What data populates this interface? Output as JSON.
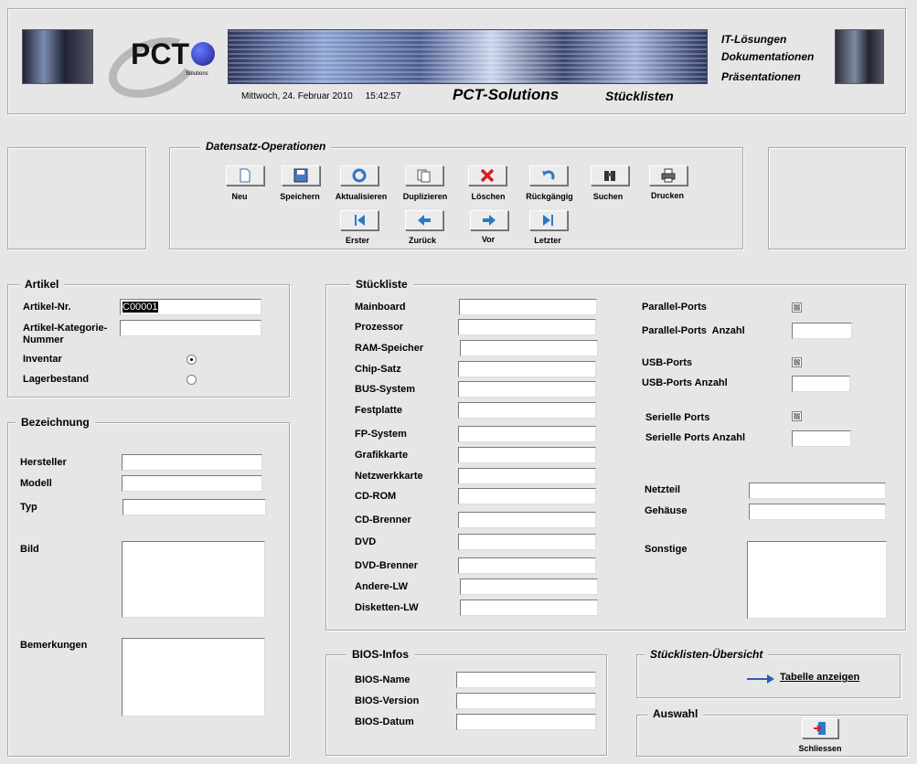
{
  "header": {
    "logo_text": "PCT",
    "logo_sub": "Solutions",
    "datetime": "Mittwoch, 24. Februar 2010     15:42:57",
    "app_name": "PCT-Solutions",
    "form_name": "Stücklisten",
    "services": [
      "IT-Lösungen",
      "Dokumentationen",
      "Präsentationen"
    ]
  },
  "ops": {
    "title": "Datensatz-Operationen",
    "row1": [
      {
        "label": "Neu",
        "icon": "new-document-icon"
      },
      {
        "label": "Speichern",
        "icon": "save-disk-icon"
      },
      {
        "label": "Aktualisieren",
        "icon": "refresh-icon"
      },
      {
        "label": "Duplizieren",
        "icon": "duplicate-icon"
      },
      {
        "label": "Löschen",
        "icon": "delete-x-icon"
      },
      {
        "label": "Rückgängig",
        "icon": "undo-icon"
      },
      {
        "label": "Suchen",
        "icon": "binoculars-icon"
      },
      {
        "label": "Drucken",
        "icon": "printer-icon"
      }
    ],
    "row2": [
      {
        "label": "Erster",
        "icon": "first-record-icon"
      },
      {
        "label": "Zurück",
        "icon": "arrow-left-icon"
      },
      {
        "label": "Vor",
        "icon": "arrow-right-icon"
      },
      {
        "label": "Letzter",
        "icon": "last-record-icon"
      }
    ]
  },
  "artikel": {
    "title": "Artikel",
    "nr_label": "Artikel-Nr.",
    "nr_value": "C00001",
    "kat_label1": "Artikel-Kategorie-",
    "kat_label2": "Nummer",
    "kat_value": "",
    "inventar_label": "Inventar",
    "lager_label": "Lagerbestand",
    "selected": "Inventar"
  },
  "bezeichnung": {
    "title": "Bezeichnung",
    "hersteller_label": "Hersteller",
    "modell_label": "Modell",
    "typ_label": "Typ",
    "bild_label": "Bild",
    "bemerkungen_label": "Bemerkungen"
  },
  "stueckliste": {
    "title": "Stückliste",
    "fields": [
      "Mainboard",
      "Prozessor",
      "RAM-Speicher",
      "Chip-Satz",
      "BUS-System",
      "Festplatte",
      "FP-System",
      "Grafikkarte",
      "Netzwerkkarte",
      "CD-ROM",
      "CD-Brenner",
      "DVD",
      "DVD-Brenner",
      "Andere-LW",
      "Disketten-LW"
    ],
    "parallel_label": "Parallel-Ports",
    "parallel_count_label": "Parallel-Ports  Anzahl",
    "usb_label": "USB-Ports",
    "usb_count_label": "USB-Ports Anzahl",
    "seriell_label": "Serielle Ports",
    "seriell_count_label": "Serielle Ports Anzahl",
    "netzteil_label": "Netzteil",
    "gehaeuse_label": "Gehäuse",
    "sonstige_label": "Sonstige"
  },
  "bios": {
    "title": "BIOS-Infos",
    "name_label": "BIOS-Name",
    "version_label": "BIOS-Version",
    "datum_label": "BIOS-Datum"
  },
  "uebersicht": {
    "title": "Stücklisten-Übersicht",
    "link_label": "Tabelle anzeigen"
  },
  "auswahl": {
    "title": "Auswahl",
    "close_label": "Schliessen"
  },
  "colors": {
    "background": "#e6e6e6",
    "field": "#ffffff",
    "accent_blue": "#2a5fb0",
    "delete_red": "#d42020"
  }
}
